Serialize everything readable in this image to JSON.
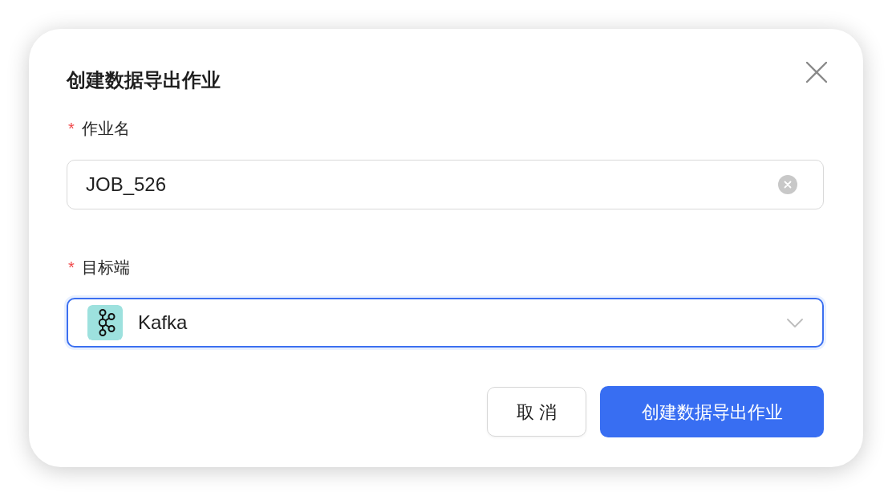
{
  "dialog": {
    "title": "创建数据导出作业",
    "fields": [
      {
        "kind": "text",
        "required_mark": "*",
        "label": "作业名",
        "value": "JOB_526",
        "focused": false
      },
      {
        "kind": "select",
        "required_mark": "*",
        "label": "目标端",
        "value": "Kafka",
        "focused": true
      }
    ],
    "buttons": [
      {
        "label": "取 消",
        "kind": "secondary"
      },
      {
        "label": "创建数据导出作业",
        "kind": "primary"
      }
    ]
  }
}
